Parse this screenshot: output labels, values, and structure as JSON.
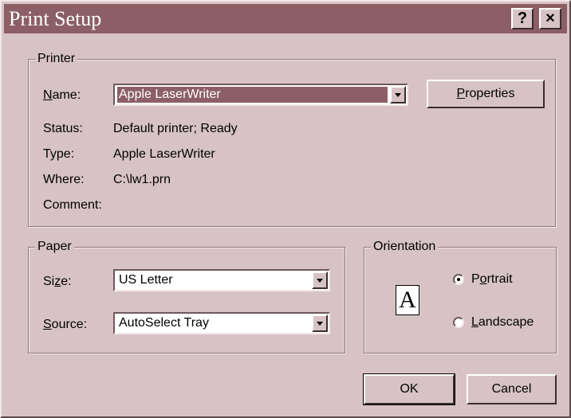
{
  "window": {
    "title": "Print Setup",
    "help_label": "?",
    "close_label": "×"
  },
  "printer": {
    "legend": "Printer",
    "name_label_first": "N",
    "name_label_rest": "ame:",
    "name_value": "Apple LaserWriter",
    "properties_first": "P",
    "properties_rest": "roperties",
    "status_label": "Status:",
    "status_value": "Default printer; Ready",
    "type_label": "Type:",
    "type_value": "Apple LaserWriter",
    "where_label": "Where:",
    "where_value": "C:\\lw1.prn",
    "comment_label": "Comment:"
  },
  "paper": {
    "legend": "Paper",
    "size_label_first": "Si",
    "size_label_u": "z",
    "size_label_rest": "e:",
    "size_value": "US Letter",
    "source_label_first": "S",
    "source_label_rest": "ource:",
    "source_value": "AutoSelect Tray"
  },
  "orientation": {
    "legend": "Orientation",
    "page_icon": "A",
    "portrait_first": "P",
    "portrait_u": "o",
    "portrait_rest": "rtrait",
    "landscape_first": "L",
    "landscape_rest": "andscape",
    "selected": "Portrait"
  },
  "buttons": {
    "ok": "OK",
    "cancel": "Cancel"
  },
  "colors": {
    "title_bar": "#8c5f66",
    "face": "#d7c3c6"
  }
}
